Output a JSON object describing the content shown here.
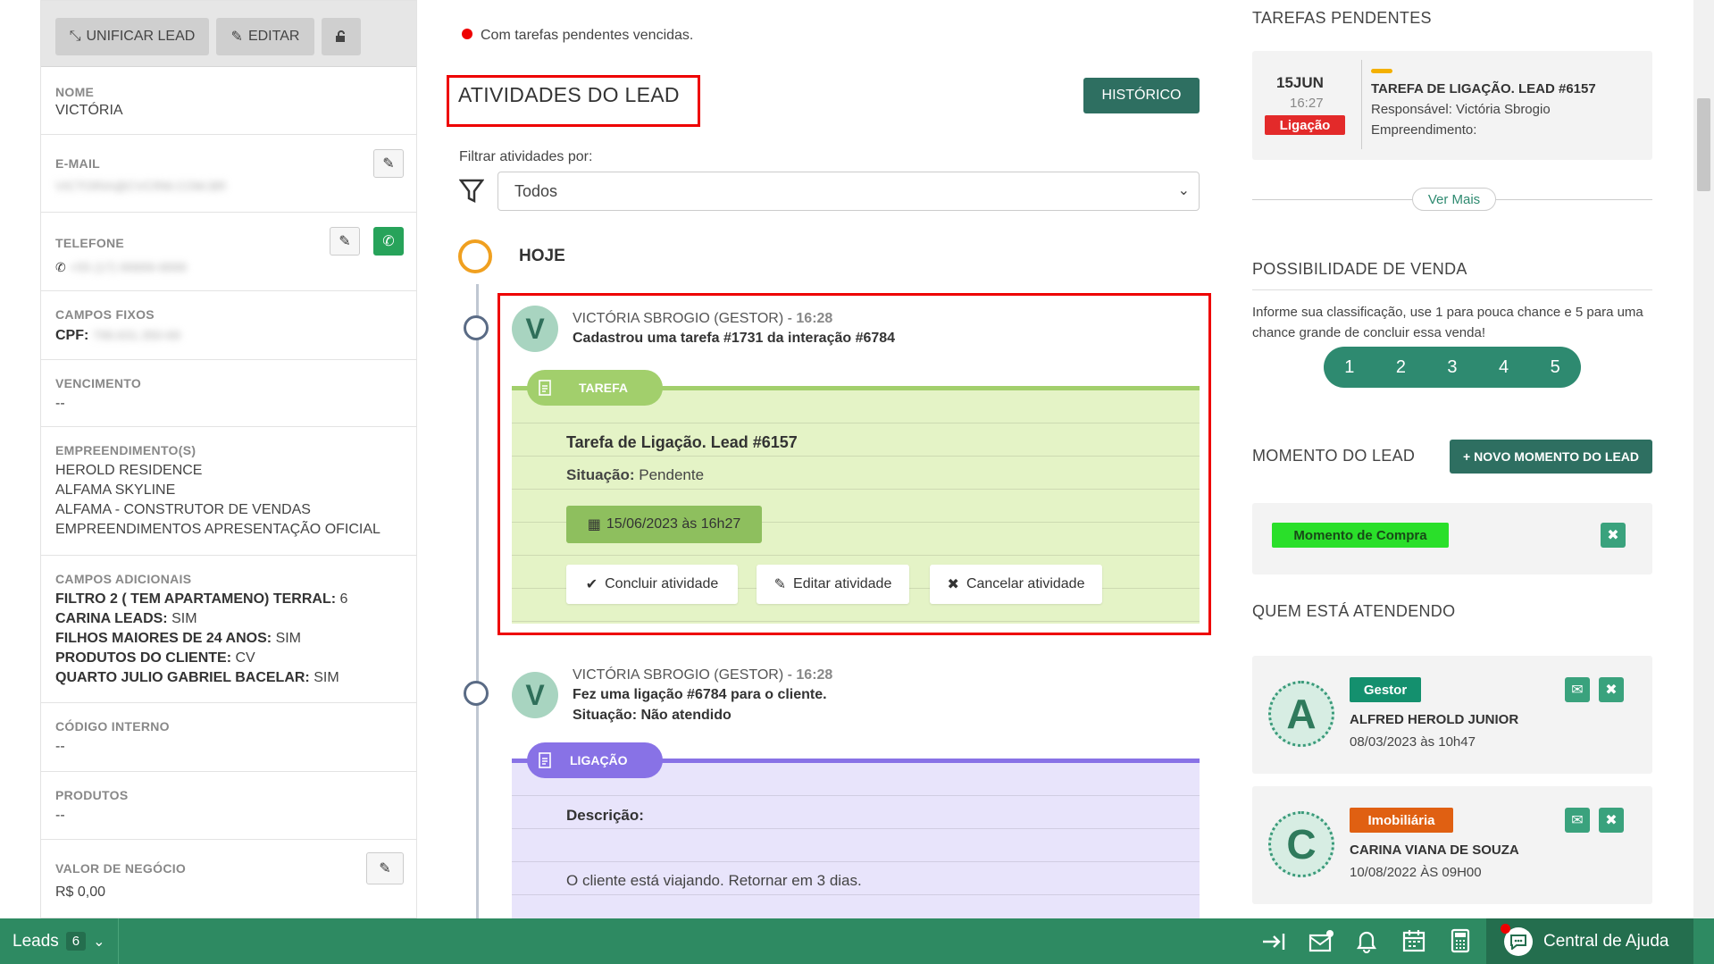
{
  "left": {
    "toolbar": {
      "unify": "UNIFICAR LEAD",
      "edit": "EDITAR"
    },
    "nome": {
      "label": "NOME",
      "value": "VICTÓRIA"
    },
    "email": {
      "label": "E-MAIL",
      "value": "VICTORIA@CVCRM.COM.BR"
    },
    "telefone": {
      "label": "TELEFONE",
      "value": "+55 (17) 99999-9999"
    },
    "campos_fixos": {
      "label": "CAMPOS FIXOS",
      "cpf_label": "CPF:",
      "cpf_value": "799.631.350-69"
    },
    "vencimento": {
      "label": "VENCIMENTO",
      "value": "--"
    },
    "empreendimentos": {
      "label": "EMPREENDIMENTO(S)",
      "items": [
        "HEROLD RESIDENCE",
        "ALFAMA SKYLINE",
        "ALFAMA - CONSTRUTOR DE VENDAS",
        "EMPREENDIMENTOS APRESENTAÇÃO OFICIAL"
      ]
    },
    "campos_adicionais": {
      "label": "CAMPOS ADICIONAIS",
      "rows": [
        {
          "k": "FILTRO 2 ( TEM APARTAMENO) TERRAL:",
          "v": "6"
        },
        {
          "k": "CARINA LEADS:",
          "v": "SIM"
        },
        {
          "k": "FILHOS MAIORES DE 24 ANOS:",
          "v": "SIM"
        },
        {
          "k": "PRODUTOS DO CLIENTE:",
          "v": "CV"
        },
        {
          "k": "QUARTO JULIO GABRIEL BACELAR:",
          "v": "SIM"
        }
      ]
    },
    "codigo_interno": {
      "label": "CÓDIGO INTERNO",
      "value": "--"
    },
    "produtos": {
      "label": "PRODUTOS",
      "value": "--"
    },
    "valor_negocio": {
      "label": "VALOR DE NEGÓCIO",
      "value": "R$ 0,00"
    }
  },
  "mid": {
    "pending_note": "Com tarefas pendentes vencidas.",
    "title": "ATIVIDADES DO LEAD",
    "historico": "HISTÓRICO",
    "filter_label": "Filtrar atividades por:",
    "filter_value": "Todos",
    "today": "HOJE",
    "card1": {
      "author": "VICTÓRIA SBROGIO (GESTOR) - ",
      "time": "16:28",
      "text": "Cadastrou uma tarefa #1731 da interação #6784",
      "tag": "TAREFA",
      "task_title": "Tarefa de Ligação. Lead #6157",
      "situacao_label": "Situação:",
      "situacao_value": "Pendente",
      "date": "15/06/2023 às 16h27",
      "btn_concluir": "Concluir atividade",
      "btn_editar": "Editar atividade",
      "btn_cancelar": "Cancelar atividade",
      "avatar": "V"
    },
    "card2": {
      "author": "VICTÓRIA SBROGIO (GESTOR) - ",
      "time": "16:28",
      "text": "Fez uma ligação #6784 para o cliente.",
      "situacao": "Situação: Não atendido",
      "tag": "LIGAÇÃO",
      "descricao_label": "Descrição:",
      "descricao": "O cliente está viajando. Retornar em 3 dias.",
      "avatar": "V"
    }
  },
  "right": {
    "tarefas_title": "TAREFAS PENDENTES",
    "task": {
      "day": "15JUN",
      "time": "16:27",
      "type": "Ligação",
      "title": "TAREFA DE LIGAÇÃO. LEAD #6157",
      "responsavel": "Responsável: Victória Sbrogio",
      "empreendimento": "Empreendimento:"
    },
    "ver_mais": "Ver Mais",
    "possibilidade_title": "POSSIBILIDADE DE VENDA",
    "possibilidade_text": "Informe sua classificação, use 1 para pouca chance e 5 para uma chance grande de concluir essa venda!",
    "ratings": [
      "1",
      "2",
      "3",
      "4",
      "5"
    ],
    "momento_title": "MOMENTO DO LEAD",
    "novo_momento": "NOVO MOMENTO DO LEAD",
    "momento_badge": "Momento de Compra",
    "quem_title": "QUEM ESTÁ ATENDENDO",
    "attendants": [
      {
        "avatar": "A",
        "role": "Gestor",
        "role_color": "#14906e",
        "name": "ALFRED HEROLD JUNIOR",
        "date": "08/03/2023 às 10h47"
      },
      {
        "avatar": "C",
        "role": "Imobiliária",
        "role_color": "#e06012",
        "name": "CARINA VIANA DE SOUZA",
        "date": "10/08/2022 ÀS 09H00"
      }
    ]
  },
  "footer": {
    "leads_label": "Leads",
    "leads_count": "6",
    "help": "Central de Ajuda"
  },
  "colors": {
    "accent": "#2e6f61",
    "footer": "#2e8a62",
    "task_bg": "#e4f3c6",
    "call_bg": "#e8e4fb",
    "highlight": "#e00000"
  }
}
